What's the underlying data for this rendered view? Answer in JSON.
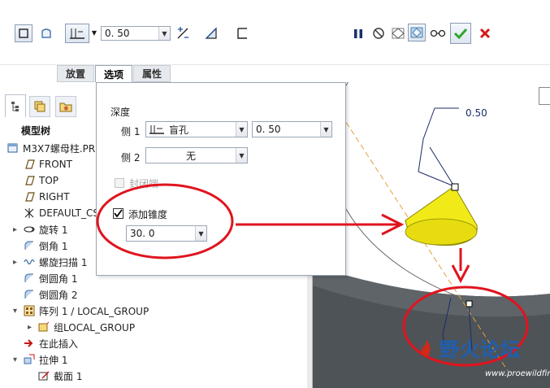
{
  "toolbar": {
    "depth_value": "0. 50",
    "tools": [
      "solid-icon",
      "surface-icon",
      "depth-type-icon",
      "flip-depth-icon",
      "remove-material-icon",
      "thicken-icon"
    ],
    "right_tools": [
      "pause-icon",
      "no-preview-icon",
      "check-model-icon",
      "verify-icon",
      "glasses-icon",
      "confirm-icon",
      "cancel-icon"
    ]
  },
  "tabs": [
    {
      "label": "放置"
    },
    {
      "label": "选项",
      "active": true
    },
    {
      "label": "属性"
    }
  ],
  "options_panel": {
    "depth_label": "深度",
    "side1_label": "侧 1",
    "side1_type": "盲孔",
    "side1_value": "0. 50",
    "side2_label": "侧 2",
    "side2_type": "无",
    "cap_ends_label": "封闭端",
    "add_taper_label": "添加锥度",
    "add_taper_checked": true,
    "taper_value": "30. 0"
  },
  "model_tree": {
    "title": "模型树",
    "items": [
      {
        "label": "M3X7螺母柱.PR",
        "icon": "part-icon",
        "indent": 0,
        "expand": ""
      },
      {
        "label": "FRONT",
        "icon": "datum-plane-icon",
        "indent": 1,
        "expand": ""
      },
      {
        "label": "TOP",
        "icon": "datum-plane-icon",
        "indent": 1,
        "expand": ""
      },
      {
        "label": "RIGHT",
        "icon": "datum-plane-icon",
        "indent": 1,
        "expand": ""
      },
      {
        "label": "DEFAULT_CS",
        "icon": "csys-icon",
        "indent": 1,
        "expand": ""
      },
      {
        "label": "旋转 1",
        "icon": "revolve-icon",
        "indent": 1,
        "expand": "▸"
      },
      {
        "label": "倒角 1",
        "icon": "chamfer-icon",
        "indent": 1,
        "expand": ""
      },
      {
        "label": "螺旋扫描 1",
        "icon": "helical-sweep-icon",
        "indent": 1,
        "expand": "▸"
      },
      {
        "label": "倒圆角 1",
        "icon": "round-icon",
        "indent": 1,
        "expand": ""
      },
      {
        "label": "倒圆角 2",
        "icon": "round-icon",
        "indent": 1,
        "expand": ""
      },
      {
        "label": "阵列 1 / LOCAL_GROUP",
        "icon": "pattern-icon",
        "indent": 1,
        "expand": "▾"
      },
      {
        "label": "组LOCAL_GROUP",
        "icon": "group-icon",
        "indent": 2,
        "expand": "▸"
      },
      {
        "label": "在此插入",
        "icon": "insert-here-icon",
        "indent": 1,
        "expand": ""
      },
      {
        "label": "拉伸 1",
        "icon": "extrude-icon",
        "indent": 1,
        "expand": "▾"
      },
      {
        "label": "截面 1",
        "icon": "sketch-icon",
        "indent": 2,
        "expand": ""
      }
    ]
  },
  "viewport": {
    "dimension_label": "0.50",
    "watermark_text": "野火论坛",
    "watermark_url": "www.proewildfire.cn"
  },
  "colors": {
    "accent_red": "#e0141e",
    "cone_yellow": "#f2ea18",
    "model_gray": "#4e5357",
    "confirm_green": "#2fa52f"
  }
}
